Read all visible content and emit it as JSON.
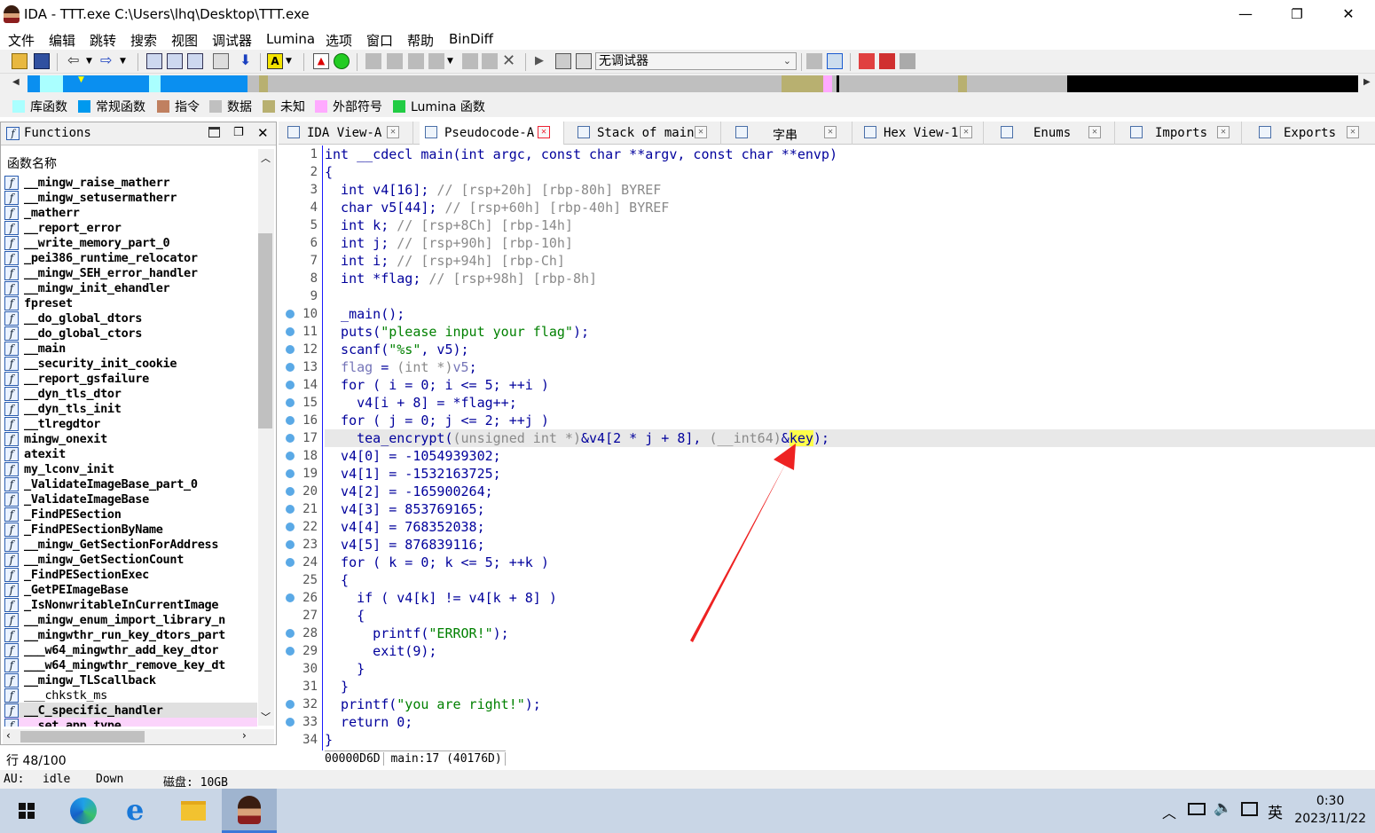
{
  "window": {
    "title": "IDA - TTT.exe C:\\Users\\lhq\\Desktop\\TTT.exe",
    "buttons": {
      "minimize": "—",
      "restore": "❐",
      "close": "✕"
    }
  },
  "menu": [
    "文件",
    "编辑",
    "跳转",
    "搜索",
    "视图",
    "调试器",
    "Lumina",
    "选项",
    "窗口",
    "帮助",
    "BinDiff"
  ],
  "toolbar": {
    "debugger_select": "无调试器"
  },
  "legend": [
    {
      "label": "库函数",
      "color": "#aaffff"
    },
    {
      "label": "常规函数",
      "color": "#0099ee"
    },
    {
      "label": "指令",
      "color": "#c08060"
    },
    {
      "label": "数据",
      "color": "#c0c0c0"
    },
    {
      "label": "未知",
      "color": "#b8b070"
    },
    {
      "label": "外部符号",
      "color": "#ffaaff"
    },
    {
      "label": "Lumina 函数",
      "color": "#22cc44"
    }
  ],
  "functions_panel": {
    "title": "Functions",
    "column_header": "函数名称",
    "items": [
      "__mingw_raise_matherr",
      "__mingw_setusermatherr",
      "_matherr",
      "__report_error",
      "__write_memory_part_0",
      "_pei386_runtime_relocator",
      "__mingw_SEH_error_handler",
      "__mingw_init_ehandler",
      "fpreset",
      "__do_global_dtors",
      "__do_global_ctors",
      "__main",
      "__security_init_cookie",
      "__report_gsfailure",
      "__dyn_tls_dtor",
      "__dyn_tls_init",
      "__tlregdtor",
      "mingw_onexit",
      "atexit",
      "my_lconv_init",
      "_ValidateImageBase_part_0",
      "_ValidateImageBase",
      "_FindPESection",
      "_FindPESectionByName",
      "__mingw_GetSectionForAddress",
      "__mingw_GetSectionCount",
      "_FindPESectionExec",
      "_GetPEImageBase",
      "_IsNonwritableInCurrentImage",
      "__mingw_enum_import_library_n",
      "__mingwthr_run_key_dtors_part",
      "___w64_mingwthr_add_key_dtor",
      "___w64_mingwthr_remove_key_dt",
      "__mingw_TLScallback",
      "___chkstk_ms",
      "__C_specific_handler",
      "__set_app_type"
    ],
    "row_status": "行 48/100"
  },
  "tabs": [
    {
      "label": "IDA View-A"
    },
    {
      "label": "Pseudocode-A"
    },
    {
      "label": "Stack of main"
    },
    {
      "label": "字串"
    },
    {
      "label": "Hex View-1"
    },
    {
      "label": "Enums"
    },
    {
      "label": "Imports"
    },
    {
      "label": "Exports"
    }
  ],
  "code_lines": [
    {
      "n": "1",
      "bp": false,
      "t": "int __cdecl main(int argc, const char **argv, const char **envp)"
    },
    {
      "n": "2",
      "bp": false,
      "t": "{"
    },
    {
      "n": "3",
      "bp": false,
      "t": "  int v4[16]; ",
      "c": "// [rsp+20h] [rbp-80h] BYREF"
    },
    {
      "n": "4",
      "bp": false,
      "t": "  char v5[44]; ",
      "c": "// [rsp+60h] [rbp-40h] BYREF"
    },
    {
      "n": "5",
      "bp": false,
      "t": "  int k; ",
      "c": "// [rsp+8Ch] [rbp-14h]"
    },
    {
      "n": "6",
      "bp": false,
      "t": "  int j; ",
      "c": "// [rsp+90h] [rbp-10h]"
    },
    {
      "n": "7",
      "bp": false,
      "t": "  int i; ",
      "c": "// [rsp+94h] [rbp-Ch]"
    },
    {
      "n": "8",
      "bp": false,
      "t": "  int *flag; ",
      "c": "// [rsp+98h] [rbp-8h]"
    },
    {
      "n": "9",
      "bp": false,
      "t": ""
    },
    {
      "n": "10",
      "bp": true,
      "t": "  _main();"
    },
    {
      "n": "11",
      "bp": true,
      "t": "  puts(\"please input your flag\");"
    },
    {
      "n": "12",
      "bp": true,
      "t": "  scanf(\"%s\", v5);"
    },
    {
      "n": "13",
      "bp": true,
      "t": "  flag = (int *)v5;"
    },
    {
      "n": "14",
      "bp": true,
      "t": "  for ( i = 0; i <= 5; ++i )"
    },
    {
      "n": "15",
      "bp": true,
      "t": "    v4[i + 8] = *flag++;"
    },
    {
      "n": "16",
      "bp": true,
      "t": "  for ( j = 0; j <= 2; ++j )"
    },
    {
      "n": "17",
      "bp": true,
      "t": "    tea_encrypt((unsigned int *)&v4[2 * j + 8], (__int64)&key);"
    },
    {
      "n": "18",
      "bp": true,
      "t": "  v4[0] = -1054939302;"
    },
    {
      "n": "19",
      "bp": true,
      "t": "  v4[1] = -1532163725;"
    },
    {
      "n": "20",
      "bp": true,
      "t": "  v4[2] = -165900264;"
    },
    {
      "n": "21",
      "bp": true,
      "t": "  v4[3] = 853769165;"
    },
    {
      "n": "22",
      "bp": true,
      "t": "  v4[4] = 768352038;"
    },
    {
      "n": "23",
      "bp": true,
      "t": "  v4[5] = 876839116;"
    },
    {
      "n": "24",
      "bp": true,
      "t": "  for ( k = 0; k <= 5; ++k )"
    },
    {
      "n": "25",
      "bp": false,
      "t": "  {"
    },
    {
      "n": "26",
      "bp": true,
      "t": "    if ( v4[k] != v4[k + 8] )"
    },
    {
      "n": "27",
      "bp": false,
      "t": "    {"
    },
    {
      "n": "28",
      "bp": true,
      "t": "      printf(\"ERROR!\");"
    },
    {
      "n": "29",
      "bp": true,
      "t": "      exit(9);"
    },
    {
      "n": "30",
      "bp": false,
      "t": "    }"
    },
    {
      "n": "31",
      "bp": false,
      "t": "  }"
    },
    {
      "n": "32",
      "bp": true,
      "t": "  printf(\"you are right!\");"
    },
    {
      "n": "33",
      "bp": true,
      "t": "  return 0;"
    },
    {
      "n": "34",
      "bp": false,
      "t": "}"
    }
  ],
  "status_line": {
    "address": "00000D6D",
    "location": "main:17 (40176D)"
  },
  "bottom_status": {
    "au_label": "AU:",
    "au_state": "idle",
    "direction": "Down",
    "disk": "磁盘: 10GB"
  },
  "taskbar": {
    "time": "0:30",
    "date": "2023/11/22",
    "ime": "英"
  }
}
